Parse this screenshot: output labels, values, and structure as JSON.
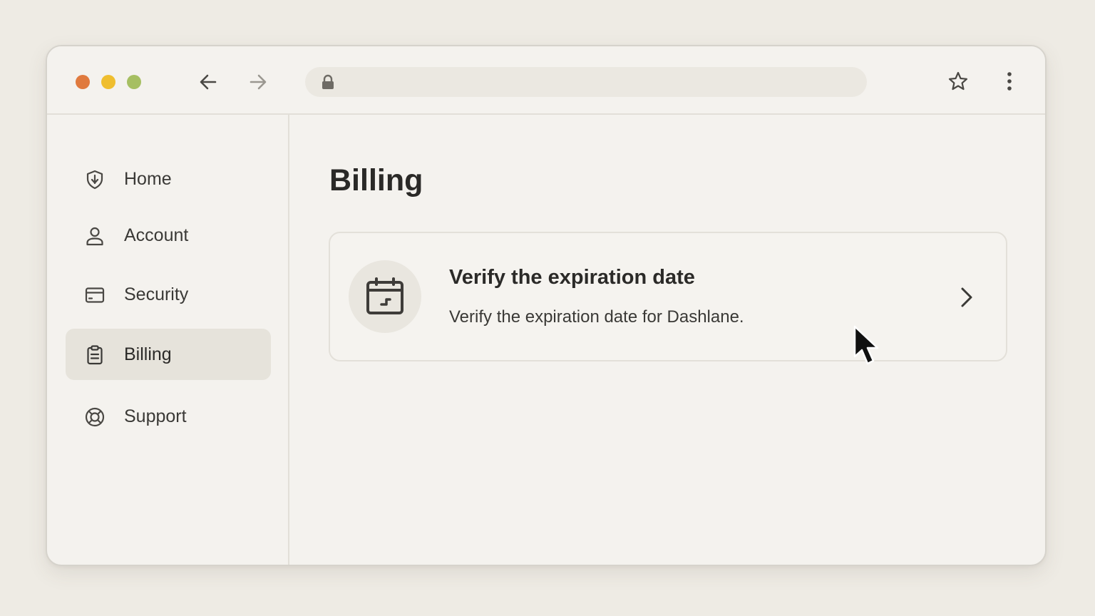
{
  "browser": {
    "url": "",
    "traffic_lights": {
      "close": "#e07a3e",
      "minimize": "#efbe2f",
      "maximize": "#a6bf62"
    }
  },
  "sidebar": {
    "items": [
      {
        "label": "Home",
        "icon": "shield-icon",
        "active": false
      },
      {
        "label": "Account",
        "icon": "user-icon",
        "active": false
      },
      {
        "label": "Security",
        "icon": "credit-card-icon",
        "active": false
      },
      {
        "label": "Billing",
        "icon": "clipboard-icon",
        "active": true
      },
      {
        "label": "Support",
        "icon": "lifebuoy-icon",
        "active": false
      }
    ]
  },
  "main": {
    "title": "Billing",
    "card": {
      "icon": "calendar-icon",
      "title": "Verify the expiration date",
      "description": "Verify the expiration date for Dashlane."
    }
  },
  "colors": {
    "background": "#eeebe4",
    "window": "#f4f2ee",
    "active_item": "#e6e3db",
    "text": "#2b2a28"
  }
}
